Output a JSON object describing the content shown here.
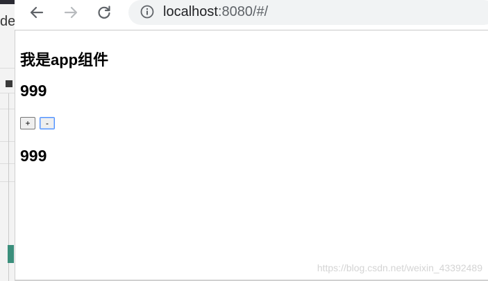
{
  "background_window": {
    "visible_text": "de"
  },
  "browser": {
    "url_host": "localhost",
    "url_rest": ":8080/#/"
  },
  "page": {
    "app_title": "我是app组件",
    "count_top": "999",
    "plus_label": "+",
    "minus_label": "-",
    "count_bottom": "999"
  },
  "watermark": "https://blog.csdn.net/weixin_43392489",
  "icons": [
    "back-arrow-icon",
    "forward-arrow-icon",
    "reload-icon",
    "info-icon"
  ],
  "colors": {
    "omnibox_bg": "#f1f3f4",
    "focus_ring": "#4d90fe",
    "bg_teal": "#3b8f7c"
  }
}
